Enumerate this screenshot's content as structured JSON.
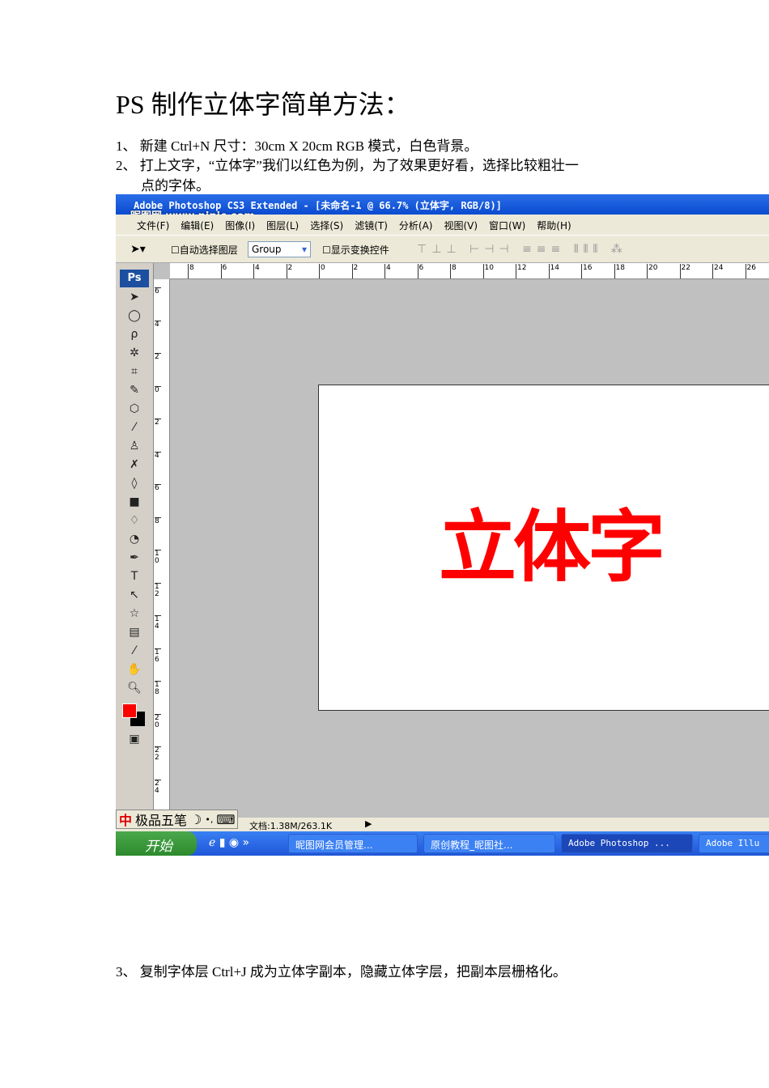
{
  "title": "PS 制作立体字简单方法：",
  "steps": [
    "1、 新建 Ctrl+N  尺寸：30cm X 20cm RGB 模式，白色背景。",
    "2、 打上文字，“立体字”我们以红色为例，为了效果更好看，选择比较粗壮一",
    "点的字体。",
    "3、 复制字体层 Ctrl+J 成为立体字副本，隐藏立体字层，把副本层栅格化。"
  ],
  "screenshot": {
    "window_title": "Adobe Photoshop CS3 Extended - [未命名-1 @ 66.7% (立体字, RGB/8)]",
    "watermark": "昵图网 www.nipic.com",
    "menu": [
      "文件(F)",
      "编辑(E)",
      "图像(I)",
      "图层(L)",
      "选择(S)",
      "滤镜(T)",
      "分析(A)",
      "视图(V)",
      "窗口(W)",
      "帮助(H)"
    ],
    "options": {
      "auto_select": "自动选择图层",
      "group": "Group",
      "show_transform": "显示变换控件"
    },
    "hruler": [
      "8",
      "6",
      "4",
      "2",
      "0",
      "2",
      "4",
      "6",
      "8",
      "10",
      "12",
      "14",
      "16",
      "18",
      "20",
      "22",
      "24",
      "26"
    ],
    "vruler": [
      "6",
      "4",
      "2",
      "0",
      "2",
      "4",
      "6",
      "8",
      "10",
      "12",
      "14",
      "16",
      "18",
      "20",
      "22",
      "24"
    ],
    "ps_logo": "Ps",
    "canvas_text": "立体字",
    "canvas_text_color": "#ff0000",
    "status": "文档:1.38M/263.1K",
    "ime": {
      "icon": "中",
      "name": "极品五笔"
    },
    "taskbar": {
      "start": "开始",
      "items": [
        "昵图网会员管理...",
        "原创教程_昵图社...",
        "Adobe Photoshop ...",
        "Adobe Illu"
      ]
    }
  }
}
